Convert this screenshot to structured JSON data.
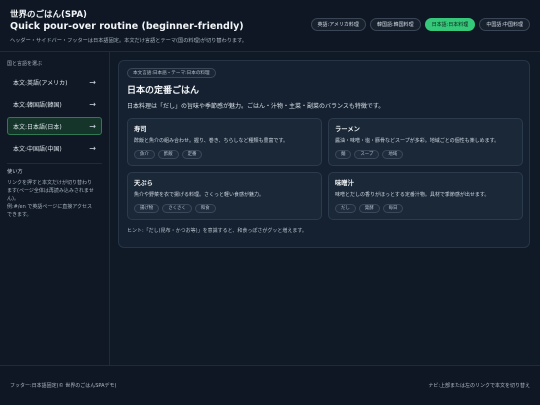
{
  "header": {
    "title": "世界のごはん(SPA)",
    "subtitle": "Quick pour-over routine (beginner-friendly)",
    "note": "ヘッダー・サイドバー・フッターは日本語固定。本文だけ言語とテーマ(国の料理)が切り替わります。",
    "tabs": [
      {
        "label": "英語:アメリカ料理",
        "active": false
      },
      {
        "label": "韓国語:韓国料理",
        "active": false
      },
      {
        "label": "日本語:日本料理",
        "active": true
      },
      {
        "label": "中国語:中国料理",
        "active": false
      }
    ]
  },
  "sidebar": {
    "heading": "国と言語を選ぶ",
    "items": [
      {
        "label": "本文:英語(アメリカ)",
        "arrow": "→",
        "active": false
      },
      {
        "label": "本文:韓国語(韓国)",
        "arrow": "→",
        "active": false
      },
      {
        "label": "本文:日本語(日本)",
        "arrow": "→",
        "active": true
      },
      {
        "label": "本文:中国語(中国)",
        "arrow": "→",
        "active": false
      }
    ],
    "howto_title": "使い方",
    "howto_lines": [
      "リンクを押すと本文だけが切り替わり",
      "ます(ページ全体は再読み込みされませ",
      "ん)。",
      "例:#/en で英語ページに直接アクセス",
      "できます。"
    ]
  },
  "main": {
    "crumb": "本文言語:日本語・テーマ:日本の料理",
    "title": "日本の定番ごはん",
    "lead": "日本料理は「だし」の旨味や季節感が魅力。ごはん・汁物・主菜・副菜のバランスも特徴です。",
    "dishes": [
      {
        "name": "寿司",
        "desc": "酢飯と魚介の組み合わせ。握り、巻き、ちらしなど種類も豊富です。",
        "tags": [
          "魚介",
          "酢飯",
          "定番"
        ]
      },
      {
        "name": "ラーメン",
        "desc": "醤油・味噌・塩・豚骨などスープが多彩。地域ごとの個性も楽しめます。",
        "tags": [
          "麺",
          "スープ",
          "地域"
        ]
      },
      {
        "name": "天ぷら",
        "desc": "魚介や野菜を衣で揚げる料理。さくっと軽い食感が魅力。",
        "tags": [
          "揚げ物",
          "さくさく",
          "和食"
        ]
      },
      {
        "name": "味噌汁",
        "desc": "味噌とだしの香りがほっとする定番汁物。具材で季節感が出せます。",
        "tags": [
          "だし",
          "発酵",
          "毎日"
        ]
      }
    ],
    "hint": "ヒント:「だし(昆布・かつお等)」を意識すると、和食っぽさがグッと増えます。"
  },
  "footer": {
    "left": "フッター:日本語固定(© 世界のごはんSPAデモ)",
    "right": "ナビ:上部または左のリンクで本文を切り替え"
  }
}
